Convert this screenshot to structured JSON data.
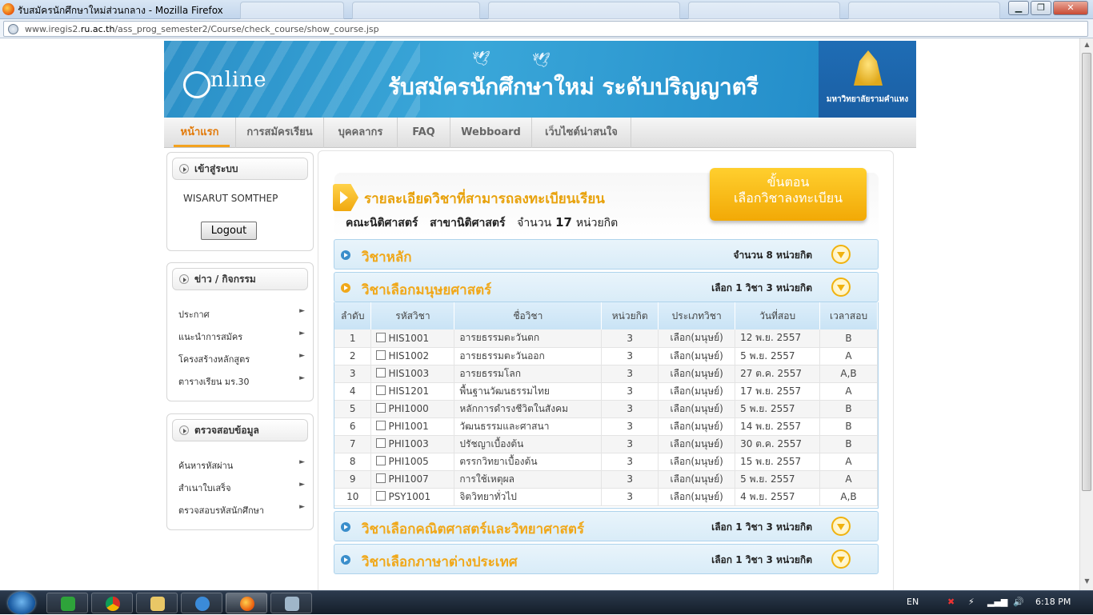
{
  "window": {
    "title": "รับสมัครนักศึกษาใหม่ส่วนกลาง - Mozilla Firefox",
    "minimize": "▁",
    "maximize": "❐",
    "close": "✕"
  },
  "address": {
    "url_prefix": "www.iregis2.",
    "url_domain": "ru.ac.th",
    "url_path": "/ass_prog_semester2/Course/check_course/show_course.jsp"
  },
  "banner": {
    "logo_text": "nline",
    "title": "รับสมัครนักศึกษาใหม่ ระดับปริญญาตรี",
    "university": "มหาวิทยาลัยรามคำแหง"
  },
  "nav": [
    {
      "label": "หน้าแรก"
    },
    {
      "label": "การสมัครเรียน"
    },
    {
      "label": "บุคคลากร"
    },
    {
      "label": "FAQ"
    },
    {
      "label": "Webboard"
    },
    {
      "label": "เว็บไซต์น่าสนใจ"
    }
  ],
  "login_box": {
    "title": "เข้าสู่ระบบ",
    "user": "WISARUT SOMTHEP",
    "logout": "Logout"
  },
  "news_box": {
    "title": "ข่าว / กิจกรรม",
    "items": [
      {
        "label": "ประกาศ"
      },
      {
        "label": "แนะนำการสมัคร"
      },
      {
        "label": "โครงสร้างหลักสูตร"
      },
      {
        "label": "ตารางเรียน มร.30"
      }
    ]
  },
  "check_box": {
    "title": "ตรวจสอบข้อมูล",
    "items": [
      {
        "label": "ค้นหารหัสผ่าน"
      },
      {
        "label": "สำเนาใบเสร็จ"
      },
      {
        "label": "ตรวจสอบรหัสนักศึกษา"
      }
    ]
  },
  "info": {
    "title": "รายละเอียดวิชาที่สามารถลงทะเบียนเรียน",
    "faculty": "คณะนิติศาสตร์",
    "major": "สาขานิติศาสตร์",
    "credits_label": "จำนวน",
    "credits_value": "17",
    "credits_unit": "หน่วยกิต",
    "step_line1": "ขั้นตอน",
    "step_line2": "เลือกวิชาลงทะเบียน"
  },
  "sections": [
    {
      "title": "วิชาหลัก",
      "info": "จำนวน 8 หน่วยกิต"
    },
    {
      "title": "วิชาเลือกมนุษยศาสตร์",
      "info": "เลือก 1 วิชา 3 หน่วยกิต"
    },
    {
      "title": "วิชาเลือกคณิตศาสตร์และวิทยาศาสตร์",
      "info": "เลือก 1 วิชา 3 หน่วยกิต"
    },
    {
      "title": "วิชาเลือกภาษาต่างประเทศ",
      "info": "เลือก 1 วิชา 3 หน่วยกิต"
    }
  ],
  "table": {
    "headers": [
      "ลำดับ",
      "รหัสวิชา",
      "ชื่อวิชา",
      "หน่วยกิต",
      "ประเภทวิชา",
      "วันที่สอบ",
      "เวลาสอบ"
    ],
    "rows": [
      {
        "no": "1",
        "code": "HIS1001",
        "name": "อารยธรรมตะวันตก",
        "credit": "3",
        "type": "เลือก(มนุษย์)",
        "date": "12 พ.ย. 2557",
        "time": "B"
      },
      {
        "no": "2",
        "code": "HIS1002",
        "name": "อารยธรรมตะวันออก",
        "credit": "3",
        "type": "เลือก(มนุษย์)",
        "date": "5 พ.ย. 2557",
        "time": "A"
      },
      {
        "no": "3",
        "code": "HIS1003",
        "name": "อารยธรรมโลก",
        "credit": "3",
        "type": "เลือก(มนุษย์)",
        "date": "27 ต.ค. 2557",
        "time": "A,B"
      },
      {
        "no": "4",
        "code": "HIS1201",
        "name": "พื้นฐานวัฒนธรรมไทย",
        "credit": "3",
        "type": "เลือก(มนุษย์)",
        "date": "17 พ.ย. 2557",
        "time": "A"
      },
      {
        "no": "5",
        "code": "PHI1000",
        "name": "หลักการดำรงชีวิตในสังคม",
        "credit": "3",
        "type": "เลือก(มนุษย์)",
        "date": "5 พ.ย. 2557",
        "time": "B"
      },
      {
        "no": "6",
        "code": "PHI1001",
        "name": "วัฒนธรรมและศาสนา",
        "credit": "3",
        "type": "เลือก(มนุษย์)",
        "date": "14 พ.ย. 2557",
        "time": "B"
      },
      {
        "no": "7",
        "code": "PHI1003",
        "name": "ปรัชญาเบื้องต้น",
        "credit": "3",
        "type": "เลือก(มนุษย์)",
        "date": "30 ต.ค. 2557",
        "time": "B"
      },
      {
        "no": "8",
        "code": "PHI1005",
        "name": "ตรรกวิทยาเบื้องต้น",
        "credit": "3",
        "type": "เลือก(มนุษย์)",
        "date": "15 พ.ย. 2557",
        "time": "A"
      },
      {
        "no": "9",
        "code": "PHI1007",
        "name": "การใช้เหตุผล",
        "credit": "3",
        "type": "เลือก(มนุษย์)",
        "date": "5 พ.ย. 2557",
        "time": "A"
      },
      {
        "no": "10",
        "code": "PSY1001",
        "name": "จิตวิทยาทั่วไป",
        "credit": "3",
        "type": "เลือก(มนุษย์)",
        "date": "4 พ.ย. 2557",
        "time": "A,B"
      }
    ]
  },
  "tray": {
    "lang": "EN",
    "time": "6:18 PM"
  },
  "colors": {
    "accent_orange": "#f0a81a",
    "banner_blue": "#2a8fc7",
    "panel_blue": "#d9ecf8"
  }
}
